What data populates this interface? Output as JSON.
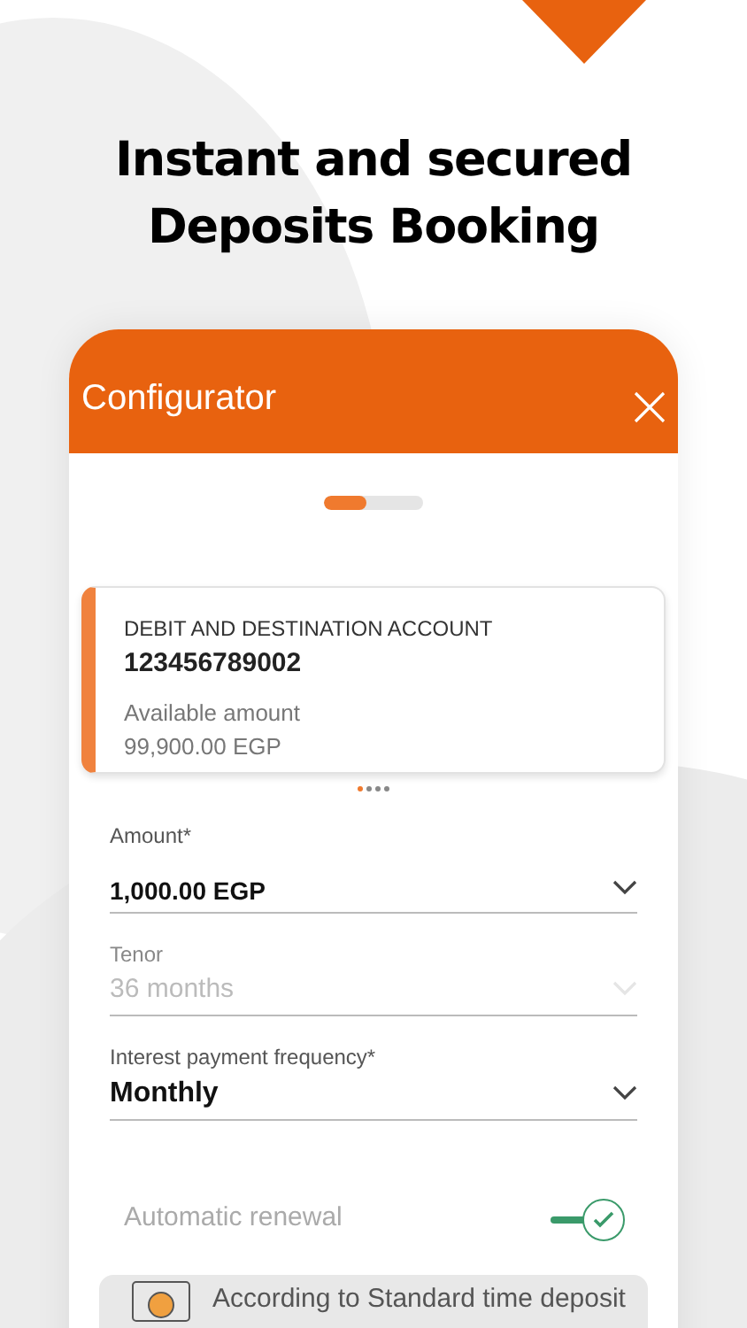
{
  "headline": "Instant and secured Deposits Booking",
  "window": {
    "title": "Configurator"
  },
  "progress": {
    "level": 0.43
  },
  "account": {
    "label": "DEBIT AND DESTINATION ACCOUNT",
    "number": "123456789002",
    "available_label": "Available amount",
    "available_value": "99,900.00 EGP"
  },
  "pager": [
    {
      "selected": true
    },
    {
      "selected": false
    },
    {
      "selected": false
    },
    {
      "selected": false
    }
  ],
  "fields": [
    {
      "label": "Amount*",
      "value": "1,000.00 EGP",
      "disabled": false,
      "kind": "amount"
    },
    {
      "label": "Tenor",
      "value": "36 months",
      "disabled": true,
      "kind": "select"
    },
    {
      "label": "Interest payment frequency*",
      "value": "Monthly",
      "disabled": false,
      "kind": "select"
    }
  ],
  "renewal": {
    "label": "Automatic renewal",
    "on": true
  },
  "notice": {
    "text": "According to Standard time deposit"
  }
}
